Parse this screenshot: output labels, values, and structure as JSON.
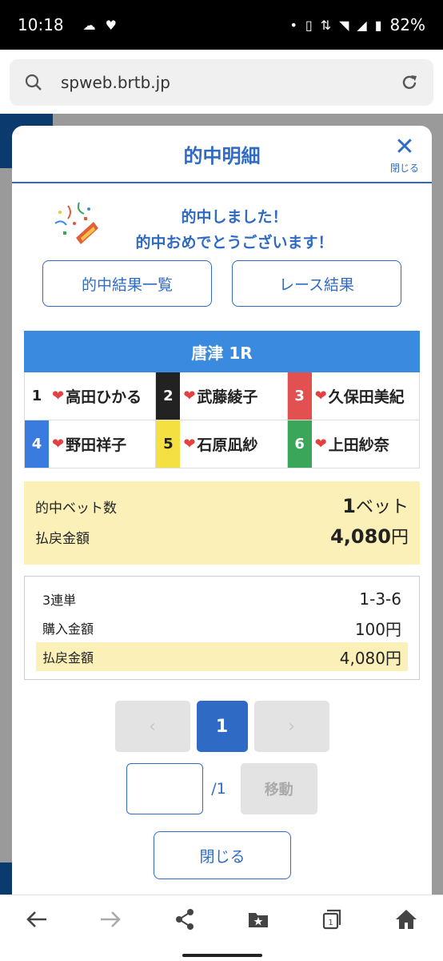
{
  "status": {
    "time": "10:18",
    "battery": "82%"
  },
  "browser": {
    "url": "spweb.brtb.jp"
  },
  "modal": {
    "title": "的中明細",
    "close_label": "閉じる",
    "congrats_line1": "的中しました！",
    "congrats_line2": "的中おめでとうございます！",
    "btn_results_list": "的中結果一覧",
    "btn_race_result": "レース結果",
    "race_header": "唐津 1R",
    "racers": [
      {
        "num": "1",
        "name": "高田ひかる",
        "bg": "#ffffff",
        "fg": "#222222"
      },
      {
        "num": "2",
        "name": "武藤綾子",
        "bg": "#222222",
        "fg": "#ffffff"
      },
      {
        "num": "3",
        "name": "久保田美紀",
        "bg": "#e2514f",
        "fg": "#ffffff"
      },
      {
        "num": "4",
        "name": "野田祥子",
        "bg": "#3a7be0",
        "fg": "#ffffff"
      },
      {
        "num": "5",
        "name": "石原凪紗",
        "bg": "#f5e042",
        "fg": "#222222"
      },
      {
        "num": "6",
        "name": "上田紗奈",
        "bg": "#3aa65a",
        "fg": "#ffffff"
      }
    ],
    "summary": {
      "hit_bets_label": "的中ベット数",
      "hit_bets_value": "1",
      "hit_bets_unit": "ベット",
      "payout_label": "払戻金額",
      "payout_value": "4,080",
      "payout_unit": "円"
    },
    "detail": {
      "bet_type": "3連単",
      "combination": "1-3-6",
      "purchase_label": "購入金額",
      "purchase_value": "100円",
      "payout_label": "払戻金額",
      "payout_value": "4,080円"
    },
    "pager": {
      "prev": "‹",
      "current": "1",
      "next": "›",
      "total": "/1",
      "move_label": "移動"
    },
    "close_button": "閉じる"
  }
}
